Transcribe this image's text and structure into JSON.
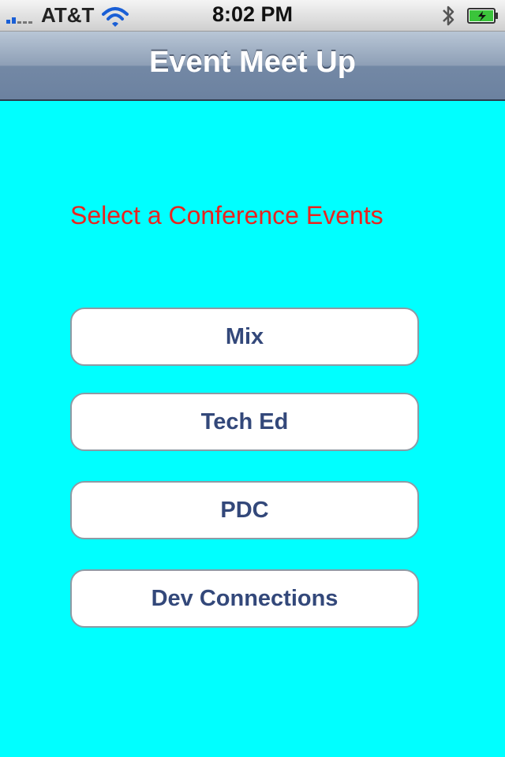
{
  "status_bar": {
    "carrier": "AT&T",
    "time": "8:02 PM",
    "signal_icon": "signal-bars-icon",
    "wifi_icon": "wifi-icon",
    "bluetooth_icon": "bluetooth-icon",
    "battery_icon": "battery-charging-icon"
  },
  "nav_bar": {
    "title": "Event Meet Up"
  },
  "main": {
    "prompt": "Select a Conference Events",
    "events": [
      {
        "label": "Mix"
      },
      {
        "label": "Tech Ed"
      },
      {
        "label": "PDC"
      },
      {
        "label": "Dev Connections"
      }
    ]
  },
  "colors": {
    "background": "#00ffff",
    "prompt_text": "#e8241f",
    "button_text": "#33487a",
    "nav_bar": "#7388a5"
  }
}
